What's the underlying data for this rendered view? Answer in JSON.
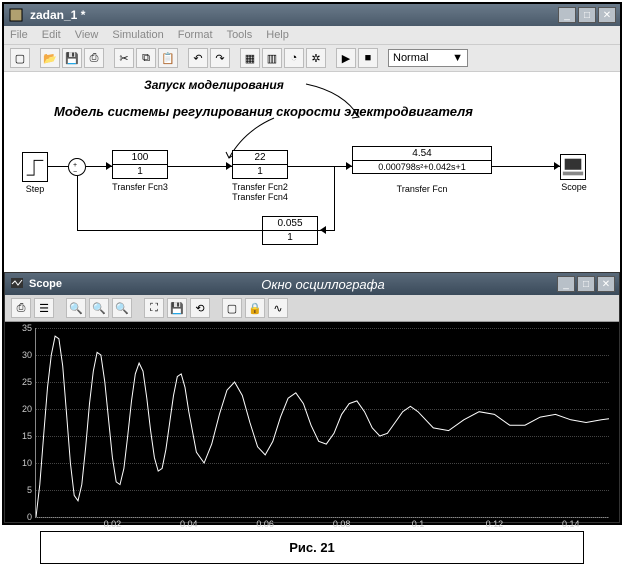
{
  "main_window": {
    "title": "zadan_1 *",
    "menu": [
      "File",
      "Edit",
      "View",
      "Simulation",
      "Format",
      "Tools",
      "Help"
    ],
    "mode": "Normal"
  },
  "annotations": {
    "run_label": "Запуск моделирования",
    "model_title": "Модель системы регулирования скорости электродвигателя"
  },
  "blocks": {
    "step": {
      "label": "Step"
    },
    "tf3": {
      "num": "100",
      "den": "1",
      "label": "Transfer Fcn3"
    },
    "tf2": {
      "num": "22",
      "den": "1",
      "label": "Transfer Fcn2"
    },
    "tf4": {
      "num": "0.055",
      "den": "1",
      "label": "Transfer Fcn4"
    },
    "tf": {
      "num": "4.54",
      "den": "0.000798s²+0.042s+1",
      "label": "Transfer Fcn"
    },
    "scope": {
      "label": "Scope"
    }
  },
  "scope_window": {
    "title_left": "Scope",
    "title_center": "Окно осциллографа"
  },
  "chart_data": {
    "type": "line",
    "title": "",
    "xlabel": "",
    "ylabel": "",
    "xlim": [
      0,
      0.15
    ],
    "ylim": [
      0,
      35
    ],
    "xticks": [
      0.02,
      0.04,
      0.06,
      0.08,
      0.1,
      0.12,
      0.14
    ],
    "yticks": [
      0,
      5,
      10,
      15,
      20,
      25,
      30,
      35
    ],
    "steady_state": 18,
    "x": [
      0.0,
      0.001,
      0.002,
      0.003,
      0.004,
      0.005,
      0.006,
      0.007,
      0.008,
      0.009,
      0.01,
      0.011,
      0.012,
      0.013,
      0.014,
      0.015,
      0.016,
      0.017,
      0.018,
      0.019,
      0.02,
      0.021,
      0.022,
      0.023,
      0.024,
      0.025,
      0.026,
      0.027,
      0.028,
      0.029,
      0.03,
      0.031,
      0.032,
      0.033,
      0.034,
      0.035,
      0.036,
      0.037,
      0.038,
      0.039,
      0.04,
      0.042,
      0.044,
      0.046,
      0.048,
      0.05,
      0.052,
      0.054,
      0.056,
      0.058,
      0.06,
      0.062,
      0.064,
      0.066,
      0.068,
      0.07,
      0.072,
      0.074,
      0.076,
      0.078,
      0.08,
      0.082,
      0.084,
      0.086,
      0.088,
      0.09,
      0.092,
      0.094,
      0.096,
      0.098,
      0.1,
      0.104,
      0.108,
      0.112,
      0.116,
      0.12,
      0.124,
      0.128,
      0.132,
      0.136,
      0.14,
      0.144,
      0.148,
      0.15
    ],
    "y": [
      0.0,
      6.0,
      15.0,
      24.0,
      30.0,
      33.5,
      33.0,
      28.0,
      19.0,
      10.0,
      4.0,
      3.0,
      6.0,
      13.0,
      21.0,
      27.0,
      30.5,
      30.0,
      25.0,
      18.0,
      11.0,
      6.5,
      6.0,
      9.0,
      15.0,
      21.5,
      26.5,
      28.5,
      27.0,
      22.0,
      16.0,
      11.0,
      8.5,
      9.0,
      12.5,
      17.5,
      22.5,
      26.0,
      26.5,
      24.0,
      19.5,
      12.0,
      10.0,
      13.5,
      19.0,
      23.5,
      25.0,
      22.5,
      17.5,
      13.0,
      11.5,
      14.0,
      18.5,
      22.0,
      23.0,
      21.0,
      17.0,
      14.0,
      13.5,
      15.5,
      19.0,
      21.0,
      21.5,
      19.5,
      16.5,
      15.0,
      15.5,
      17.5,
      19.5,
      20.5,
      19.5,
      16.5,
      16.0,
      18.0,
      19.5,
      19.0,
      17.0,
      17.0,
      18.5,
      19.0,
      18.0,
      17.5,
      18.0,
      18.2
    ]
  },
  "caption": "Рис. 21"
}
